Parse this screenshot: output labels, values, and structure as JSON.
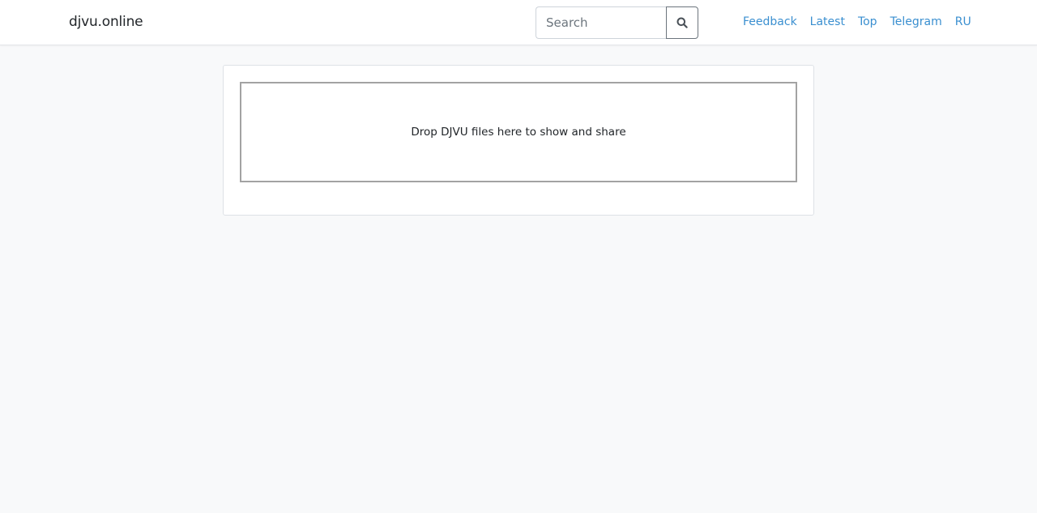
{
  "navbar": {
    "brand": "djvu.online",
    "search": {
      "placeholder": "Search",
      "value": "",
      "button_icon": "search-icon"
    },
    "links": [
      "Feedback",
      "Latest",
      "Top",
      "Telegram",
      "RU"
    ]
  },
  "main": {
    "dropzone_text": "Drop DJVU files here to show and share"
  },
  "colors": {
    "link": "#3a8fd0",
    "background": "#f8f9fa",
    "navbar_background": "#ffffff"
  }
}
